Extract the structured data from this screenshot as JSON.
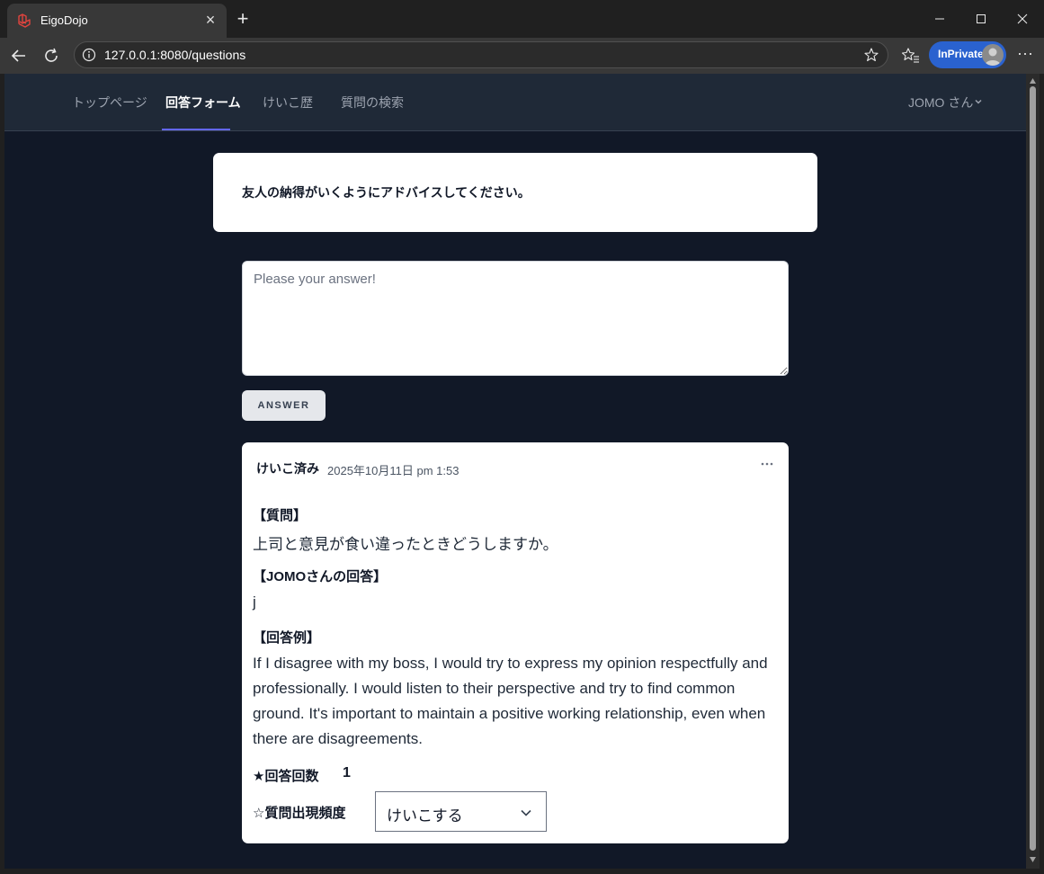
{
  "browser": {
    "tab_title": "EigoDojo",
    "url": "127.0.0.1:8080/questions",
    "inprivate_label": "InPrivate"
  },
  "nav": {
    "links": [
      "トップページ",
      "回答フォーム",
      "けいこ歴",
      "質問の検索"
    ],
    "active_index": 1,
    "user_menu": "JOMO さん"
  },
  "question": {
    "prompt": "友人の納得がいくようにアドバイスしてください。"
  },
  "answer_form": {
    "value": "",
    "placeholder": "Please your answer!",
    "submit_label": "ANSWER"
  },
  "history_card": {
    "status": "けいこ済み",
    "date": "2025年10月11日 pm 1:53",
    "question_heading": "【質問】",
    "question_text": "上司と意見が食い違ったときどうしますか。",
    "user_answer_heading": "【JOMOさんの回答】",
    "user_answer_text": "j",
    "example_heading": "【回答例】",
    "example_text": "If I disagree with my boss, I would try to express my opinion respectfully and professionally. I would listen to their perspective and try to find common ground. It's important to maintain a positive working relationship, even when there are disagreements.",
    "answer_count_label": "★回答回数",
    "answer_count_value": "1",
    "frequency_label": "☆質問出現頻度",
    "frequency_selected": "けいこする"
  },
  "colors": {
    "page_bg": "#111827",
    "nav_bg": "#1f2937",
    "nav_active_underline": "#6366f1",
    "inprivate_badge": "#2a62cf",
    "favicon": "#e0443e"
  }
}
